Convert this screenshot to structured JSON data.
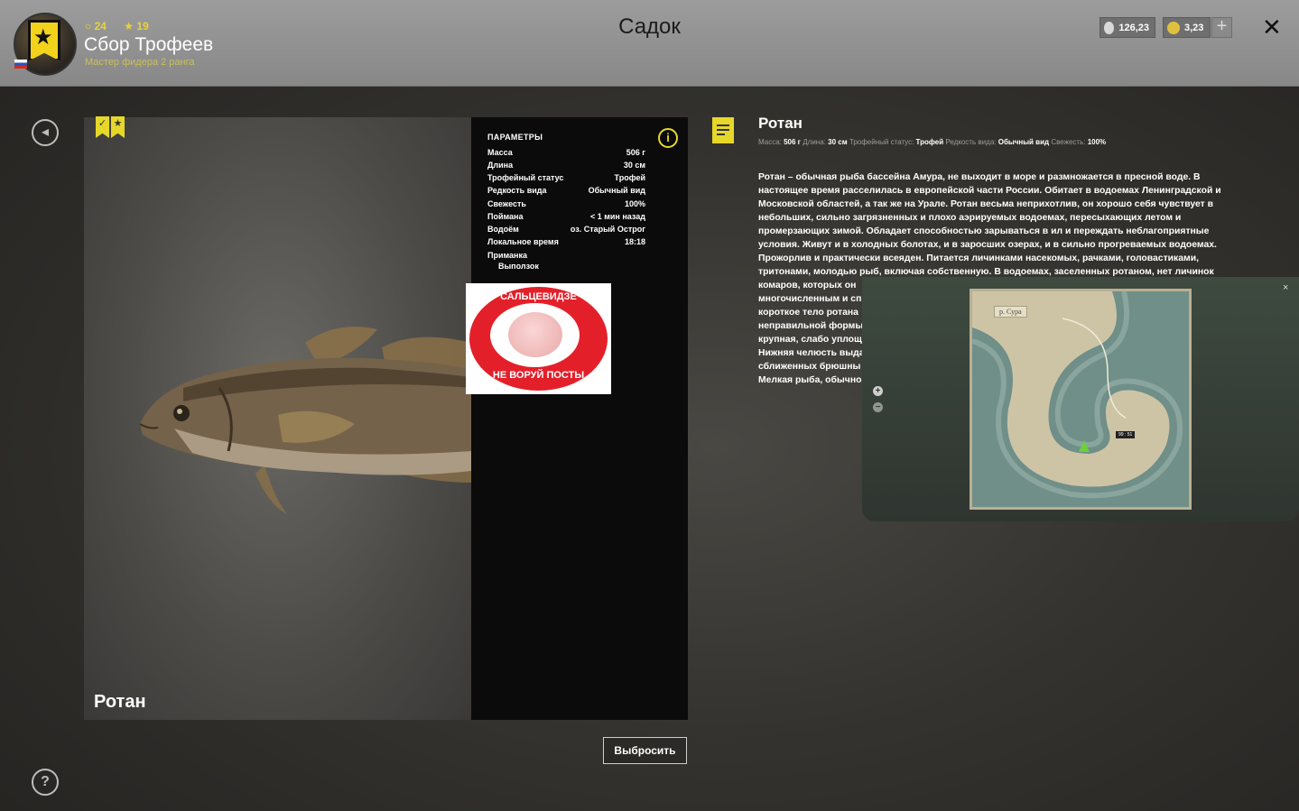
{
  "header": {
    "stat_level": "24",
    "stat_stars": "19",
    "player_name": "Сбор Трофеев",
    "rank": "Мастер фидера 2 ранга",
    "page_title": "Садок",
    "silver": "126,23",
    "gold": "3,23",
    "plus": "+",
    "close": "✕"
  },
  "fish": {
    "name": "Ротан"
  },
  "params": {
    "title": "ПАРАМЕТРЫ",
    "rows": [
      {
        "label": "Масса",
        "value": "506 г"
      },
      {
        "label": "Длина",
        "value": "30 см"
      },
      {
        "label": "Трофейный статус",
        "value": "Трофей"
      },
      {
        "label": "Редкость вида",
        "value": "Обычный вид"
      },
      {
        "label": "Свежесть",
        "value": "100%"
      },
      {
        "label": "Поймана",
        "value": "< 1 мин назад"
      },
      {
        "label": "Водоём",
        "value": "оз. Старый Острог"
      },
      {
        "label": "Локальное время",
        "value": "18:18"
      }
    ],
    "bait_label": "Приманка",
    "bait_value": "Выползок"
  },
  "sticker": {
    "top": "САЛЬЦЕВИДЗЕ",
    "bottom": "НЕ ВОРУЙ ПОСТЫ"
  },
  "actions": {
    "discard": "Выбросить"
  },
  "description": {
    "title": "Ротан",
    "meta": [
      {
        "k": "Масса:",
        "v": "506 г"
      },
      {
        "k": "Длина:",
        "v": "30 см"
      },
      {
        "k": "Трофейный статус:",
        "v": "Трофей"
      },
      {
        "k": "Редкость вида:",
        "v": "Обычный вид"
      },
      {
        "k": "Свежесть:",
        "v": "100%"
      }
    ],
    "lines": [
      "Ротан – обычная рыба бассейна Амура, не выходит в море и размножается в пресной воде. В",
      "настоящее время расселилась в европейской части России. Обитает в водоемах Ленинградской и",
      "Московской областей, а так же на Урале. Ротан весьма неприхотлив, он хорошо себя чувствует в",
      "небольших, сильно загрязненных и плохо аэрируемых водоемах, пересыхающих летом и",
      "промерзающих зимой. Обладает способностью зарываться в ил и переждать неблагоприятные",
      "условия. Живут и в холодных болотах, и в заросших озерах, и в сильно прогреваемых водоемах.",
      "Прожорлив и практически всеяден. Питается личинками насекомых, рачками, головастиками,",
      "тритонами, молодью рыб, включая собственную. В водоемах, заселенных ротаном, нет личинок",
      "комаров, которых он",
      "многочисленным и сп",
      "короткое тело ротана",
      "неправильной формы",
      "крупная, слабо уплощ",
      "Нижняя челюсть выда",
      "сближенных брюшны",
      "Мелкая рыба, обычно"
    ]
  },
  "map": {
    "river_label": "р. Сура",
    "marker": "99 : 51",
    "close": "×",
    "zoom_in": "+",
    "zoom_out": "−"
  },
  "colors": {
    "accent": "#e6d82a",
    "header_bg": "#9c9c9c"
  }
}
